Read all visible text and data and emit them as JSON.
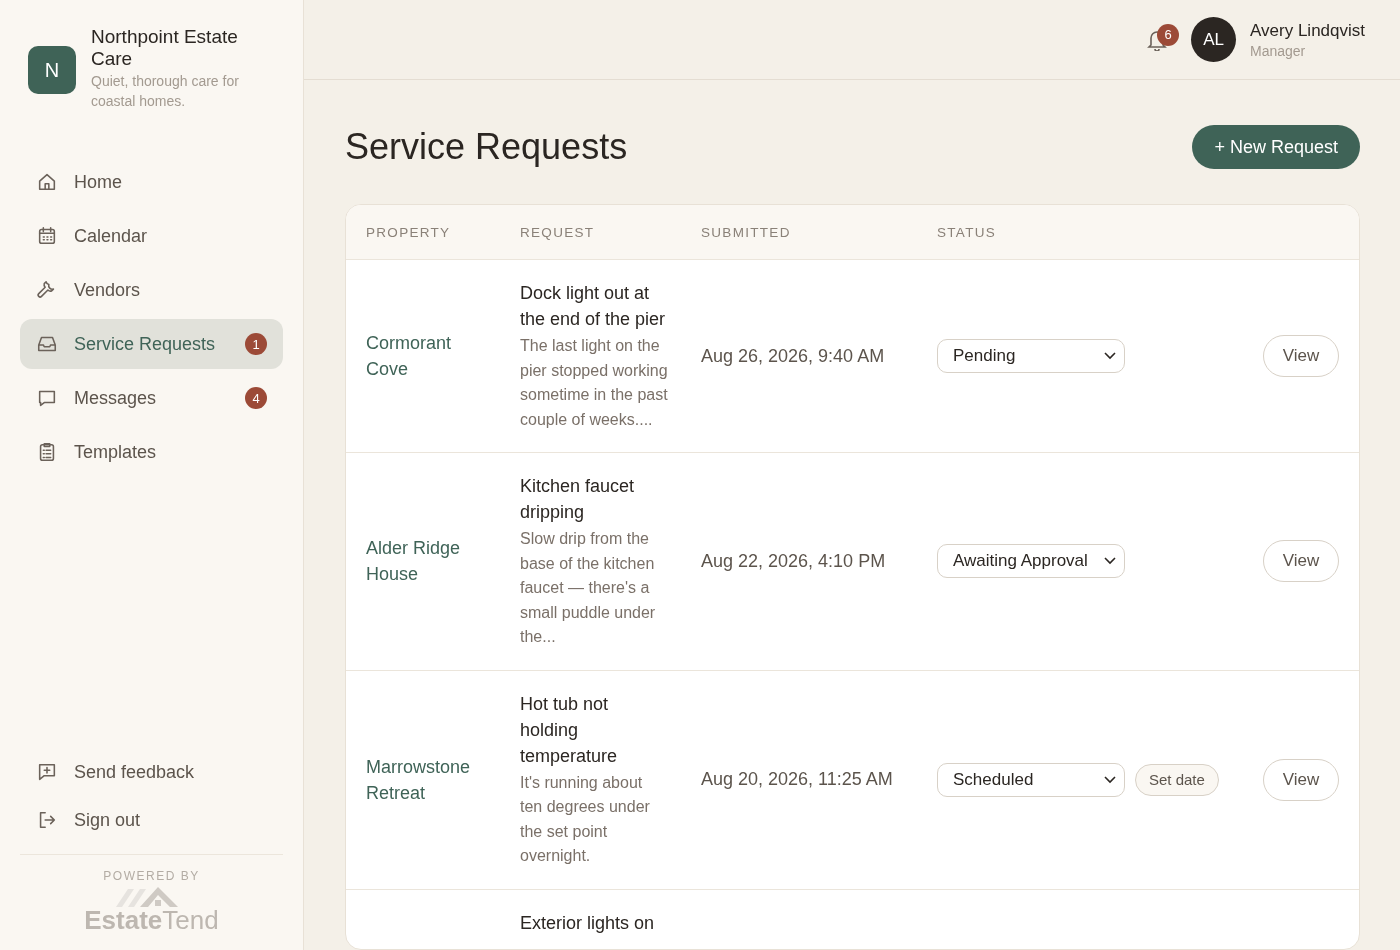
{
  "brand": {
    "initial": "N",
    "name": "Northpoint Estate Care",
    "tagline": "Quiet, thorough care for coastal homes."
  },
  "nav": [
    {
      "label": "Home",
      "selected": false
    },
    {
      "label": "Calendar",
      "selected": false
    },
    {
      "label": "Vendors",
      "selected": false
    },
    {
      "label": "Service Requests",
      "selected": true,
      "badge": "1"
    },
    {
      "label": "Messages",
      "selected": false,
      "badge": "4"
    },
    {
      "label": "Templates",
      "selected": false
    }
  ],
  "footer_nav": [
    {
      "label": "Send feedback"
    },
    {
      "label": "Sign out"
    }
  ],
  "powered_by": {
    "caption": "POWERED BY",
    "logo": "**Estate**Tend"
  },
  "topbar": {
    "notifications": "6",
    "user": {
      "initials": "AL",
      "name": "Avery Lindqvist",
      "role": "Manager"
    }
  },
  "page": {
    "title": "Service Requests",
    "new_button": "+ New Request"
  },
  "table": {
    "columns": [
      "PROPERTY",
      "REQUEST",
      "SUBMITTED",
      "STATUS"
    ],
    "rows": [
      {
        "property": "Cormorant Cove",
        "title": "Dock light out at the end of the pier",
        "description": "The last light on the pier stopped working sometime in the past couple of weeks....",
        "submitted": "Aug 26, 2026, 9:40 AM",
        "status": "Pending",
        "action": "View"
      },
      {
        "property": "Alder Ridge House",
        "title": "Kitchen faucet dripping",
        "description": "Slow drip from the base of the kitchen faucet — there's a small puddle under the...",
        "submitted": "Aug 22, 2026, 4:10 PM",
        "status": "Awaiting Approval",
        "action": "View"
      },
      {
        "property": "Marrowstone Retreat",
        "title": "Hot tub not holding temperature",
        "description": "It's running about ten degrees under the set point overnight.",
        "submitted": "Aug 20, 2026, 11:25 AM",
        "status": "Scheduled",
        "extra_button": "Set date",
        "action": "View"
      },
      {
        "title": "Exterior lights on"
      }
    ]
  }
}
